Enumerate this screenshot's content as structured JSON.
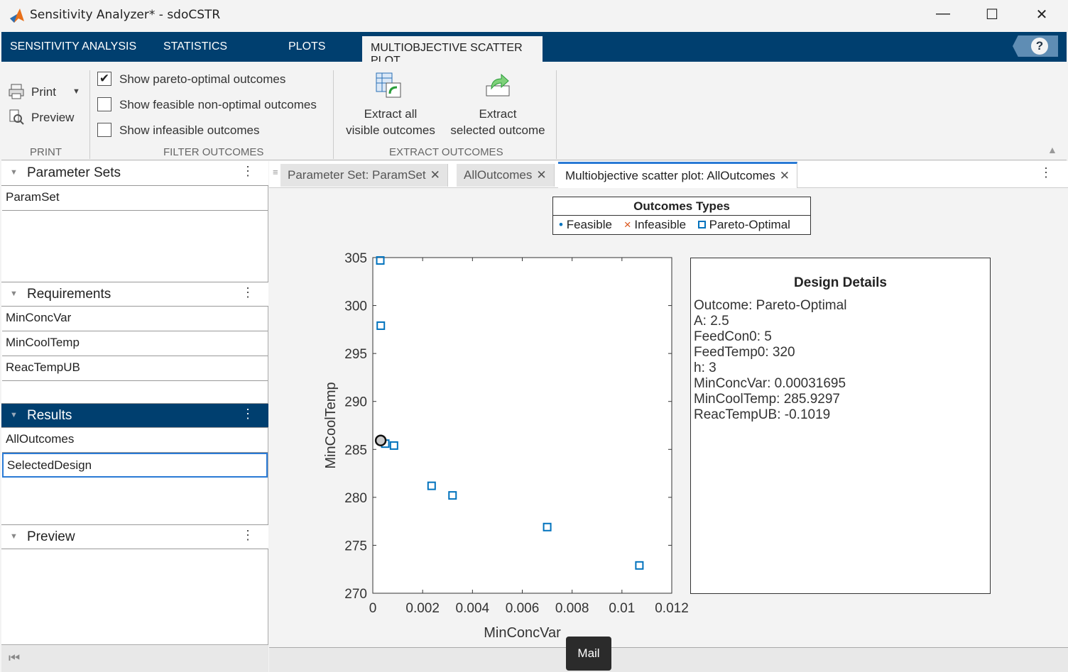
{
  "window": {
    "title": "Sensitivity Analyzer* - sdoCSTR",
    "minimize": "—",
    "maximize": "☐",
    "close": "✕"
  },
  "ribbon_tabs": [
    "SENSITIVITY ANALYSIS",
    "STATISTICS",
    "PLOTS",
    "MULTIOBJECTIVE SCATTER PLOT"
  ],
  "help": "?",
  "print": {
    "print_label": "Print",
    "preview_label": "Preview",
    "section": "PRINT"
  },
  "filter": {
    "section": "FILTER OUTCOMES",
    "options": [
      {
        "label": "Show pareto-optimal outcomes",
        "checked": true
      },
      {
        "label": "Show feasible non-optimal outcomes",
        "checked": false
      },
      {
        "label": "Show infeasible outcomes",
        "checked": false
      }
    ]
  },
  "extract": {
    "section": "EXTRACT OUTCOMES",
    "all_line1": "Extract all",
    "all_line2": "visible outcomes",
    "sel_line1": "Extract",
    "sel_line2": "selected outcome"
  },
  "sidebar": {
    "parameter_sets": {
      "title": "Parameter Sets",
      "items": [
        "ParamSet"
      ]
    },
    "requirements": {
      "title": "Requirements",
      "items": [
        "MinConcVar",
        "MinCoolTemp",
        "ReacTempUB"
      ]
    },
    "results": {
      "title": "Results",
      "items": [
        "AllOutcomes",
        "SelectedDesign"
      ],
      "selected": "SelectedDesign"
    },
    "preview": {
      "title": "Preview"
    }
  },
  "doc_tabs": [
    "Parameter Set: ParamSet",
    "AllOutcomes",
    "Multiobjective scatter plot: AllOutcomes"
  ],
  "legend": {
    "title": "Outcomes Types",
    "items": [
      "Feasible",
      "Infeasible",
      "Pareto-Optimal"
    ]
  },
  "details": {
    "title": "Design Details",
    "lines": [
      "Outcome: Pareto-Optimal",
      "A: 2.5",
      "FeedCon0: 5",
      "FeedTemp0: 320",
      "h: 3",
      "MinConcVar: 0.00031695",
      "MinCoolTemp: 285.9297",
      "ReacTempUB: -0.1019"
    ]
  },
  "tooltip": "Mail",
  "colors": {
    "accent": "#003f6f",
    "pareto": "#0072bd",
    "infeasible": "#d95319"
  },
  "chart_data": {
    "type": "scatter",
    "xlabel": "MinConcVar",
    "ylabel": "MinCoolTemp",
    "xlim": [
      0,
      0.012
    ],
    "ylim": [
      270,
      305
    ],
    "xticks": [
      "0",
      "0.002",
      "0.004",
      "0.006",
      "0.008",
      "0.01",
      "0.012"
    ],
    "yticks": [
      "270",
      "275",
      "280",
      "285",
      "290",
      "295",
      "300",
      "305"
    ],
    "series": [
      {
        "name": "Pareto-Optimal",
        "x": [
          0.0003,
          0.00032,
          0.0005,
          0.00085,
          0.00236,
          0.0032,
          0.007,
          0.0107
        ],
        "y": [
          304.7,
          297.9,
          285.6,
          285.4,
          281.2,
          280.2,
          276.9,
          272.9
        ]
      }
    ],
    "selected": {
      "x": 0.00031695,
      "y": 285.9297
    }
  }
}
